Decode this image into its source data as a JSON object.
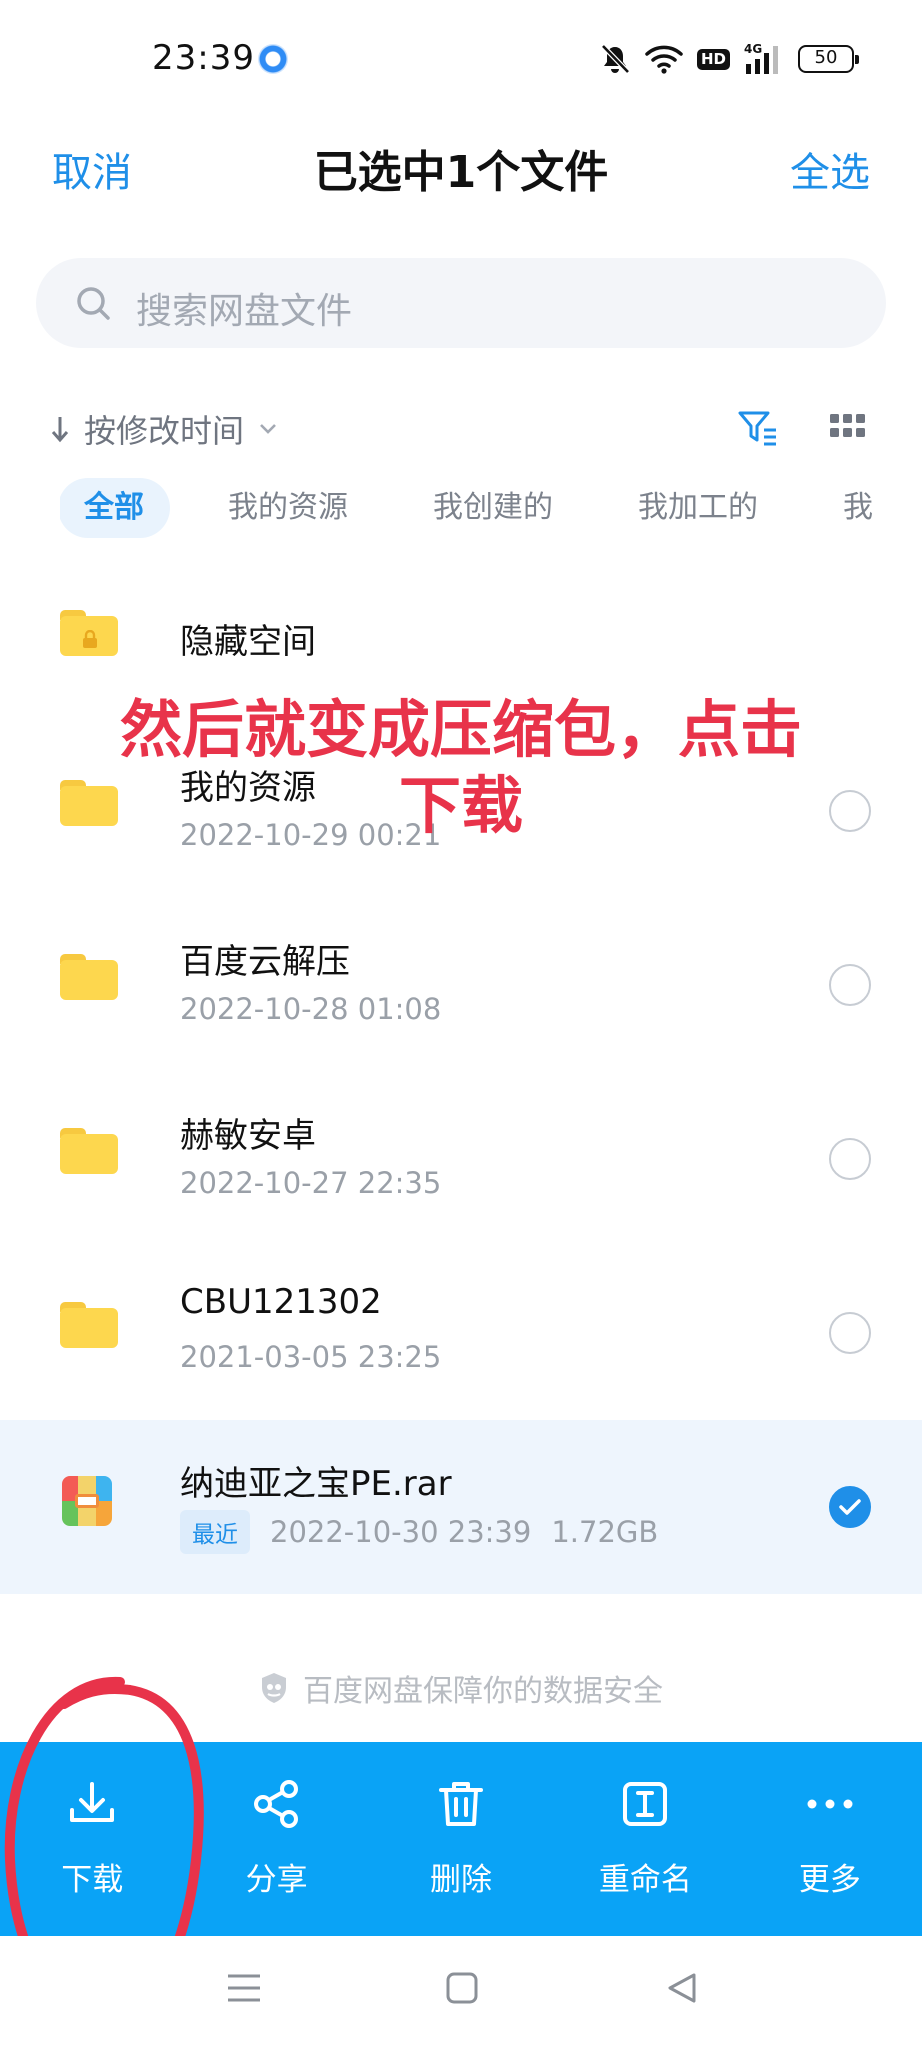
{
  "status": {
    "time": "23:39",
    "icons": [
      "app-notification-icon",
      "mute-icon",
      "wifi-icon",
      "hd-icon",
      "signal-4g-icon",
      "battery-icon"
    ],
    "hd": "HD",
    "network": "4G",
    "battery": "50"
  },
  "header": {
    "cancel": "取消",
    "title": "已选中1个文件",
    "select_all": "全选"
  },
  "search": {
    "placeholder": "搜索网盘文件"
  },
  "sort": {
    "label": "按修改时间"
  },
  "tabs": [
    {
      "label": "全部",
      "active": true
    },
    {
      "label": "我的资源",
      "active": false
    },
    {
      "label": "我创建的",
      "active": false
    },
    {
      "label": "我加工的",
      "active": false
    },
    {
      "label": "我",
      "active": false
    }
  ],
  "files": [
    {
      "name": "隐藏空间",
      "type": "locked-folder"
    },
    {
      "name": "我的资源",
      "date": "2022-10-29  00:21",
      "type": "folder",
      "selected": false
    },
    {
      "name": "百度云解压",
      "date": "2022-10-28  01:08",
      "type": "folder",
      "selected": false
    },
    {
      "name": "赫敏安卓",
      "date": "2022-10-27  22:35",
      "type": "folder",
      "selected": false
    },
    {
      "name": "CBU121302",
      "date": "2021-03-05  23:25",
      "type": "folder",
      "selected": false
    },
    {
      "name": "纳迪亚之宝PE.rar",
      "badge": "最近",
      "date": "2022-10-30  23:39",
      "size": "1.72GB",
      "type": "archive",
      "selected": true
    }
  ],
  "annotation": {
    "line1": "然后就变成压缩包，点击",
    "line2": "下载",
    "color": "#e8334a"
  },
  "footer_note": "百度网盘保障你的数据安全",
  "actions": [
    {
      "label": "下载",
      "icon": "download-icon"
    },
    {
      "label": "分享",
      "icon": "share-icon"
    },
    {
      "label": "删除",
      "icon": "trash-icon"
    },
    {
      "label": "重命名",
      "icon": "rename-icon"
    },
    {
      "label": "更多",
      "icon": "more-icon"
    }
  ],
  "colors": {
    "accent": "#1f8fe8",
    "action_bar": "#0aa3f6",
    "folder": "#fdd74e",
    "selected_row": "#eef5fd"
  }
}
